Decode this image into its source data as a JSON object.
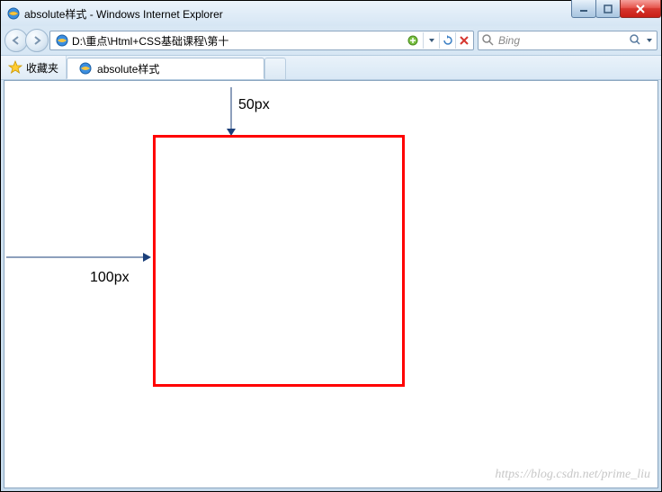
{
  "window": {
    "title": "absolute样式 - Windows Internet Explorer"
  },
  "nav": {
    "address": "D:\\重点\\Html+CSS基础课程\\第十",
    "search_placeholder": "Bing"
  },
  "favorites": {
    "label": "收藏夹"
  },
  "tab": {
    "title": "absolute样式"
  },
  "content": {
    "top_label": "50px",
    "left_label": "100px"
  },
  "watermark": "https://blog.csdn.net/prime_liu"
}
